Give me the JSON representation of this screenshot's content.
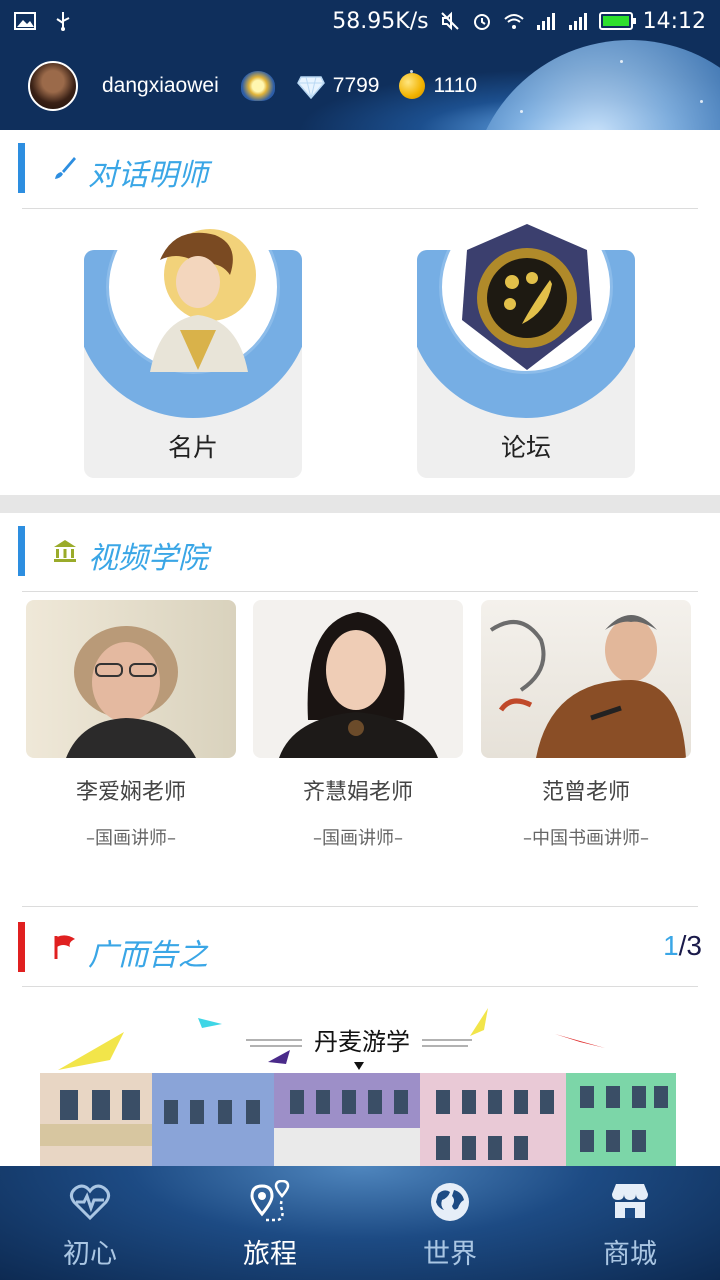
{
  "status_bar": {
    "speed": "58.95K/s",
    "time": "14:12"
  },
  "user": {
    "username": "dangxiaowei",
    "diamonds": "7799",
    "coins": "1110"
  },
  "dialogue_section": {
    "title": "对话明师",
    "cards": [
      {
        "label": "名片"
      },
      {
        "label": "论坛"
      }
    ]
  },
  "video_section": {
    "title": "视频学院",
    "teachers": [
      {
        "name": "李爱娴老师",
        "role": "–国画讲师–"
      },
      {
        "name": "齐慧娟老师",
        "role": "–国画讲师–"
      },
      {
        "name": "范曾老师",
        "role": "–中国书画讲师–"
      }
    ]
  },
  "ad_section": {
    "title": "广而告之",
    "pager_current": "1",
    "pager_total": "/3",
    "banner_title": "丹麦游学"
  },
  "bottom_nav": [
    {
      "label": "初心",
      "icon": "heartbeat-icon"
    },
    {
      "label": "旅程",
      "icon": "route-pin-icon",
      "active": true
    },
    {
      "label": "世界",
      "icon": "globe-icon"
    },
    {
      "label": "商城",
      "icon": "store-icon"
    }
  ],
  "colors": {
    "accent_blue": "#3aa6e6",
    "section_bar_blue": "#2d8ee0",
    "section_bar_red": "#e02020",
    "card_ring": "#76aee4"
  }
}
